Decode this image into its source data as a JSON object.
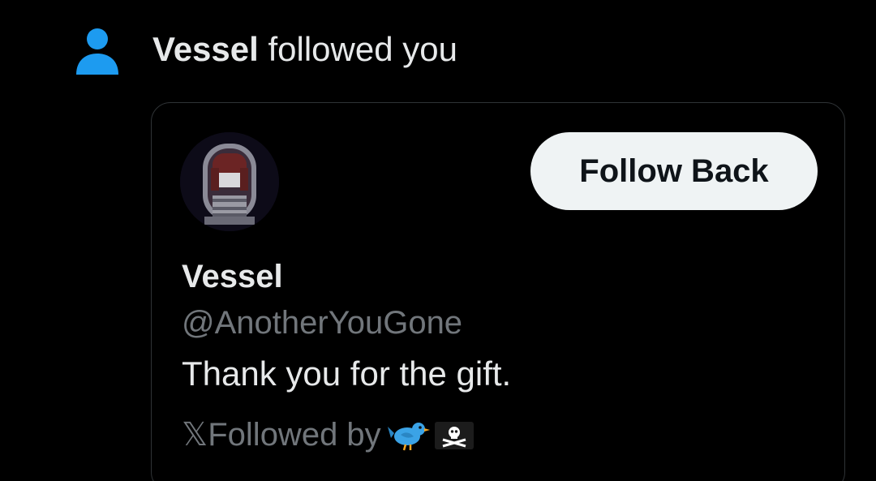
{
  "notification": {
    "icon": "person-icon",
    "icon_color": "#1d9bf0",
    "actor_name": "Vessel",
    "action_text": " followed you"
  },
  "card": {
    "avatar": "pixel-art-avatar",
    "follow_button_label": "Follow Back",
    "display_name": "Vessel",
    "handle": "@AnotherYouGone",
    "bio": "Thank you for the gift.",
    "followed_by_prefix": "𝕏",
    "followed_by_label": "Followed by",
    "followed_by_emojis": [
      "bird-emoji",
      "pirate-flag-emoji"
    ]
  },
  "colors": {
    "background": "#000000",
    "text_primary": "#e7e9ea",
    "text_secondary": "#71767b",
    "border": "#2f3336",
    "button_bg": "#eff3f4",
    "button_text": "#0f1419",
    "accent": "#1d9bf0"
  }
}
